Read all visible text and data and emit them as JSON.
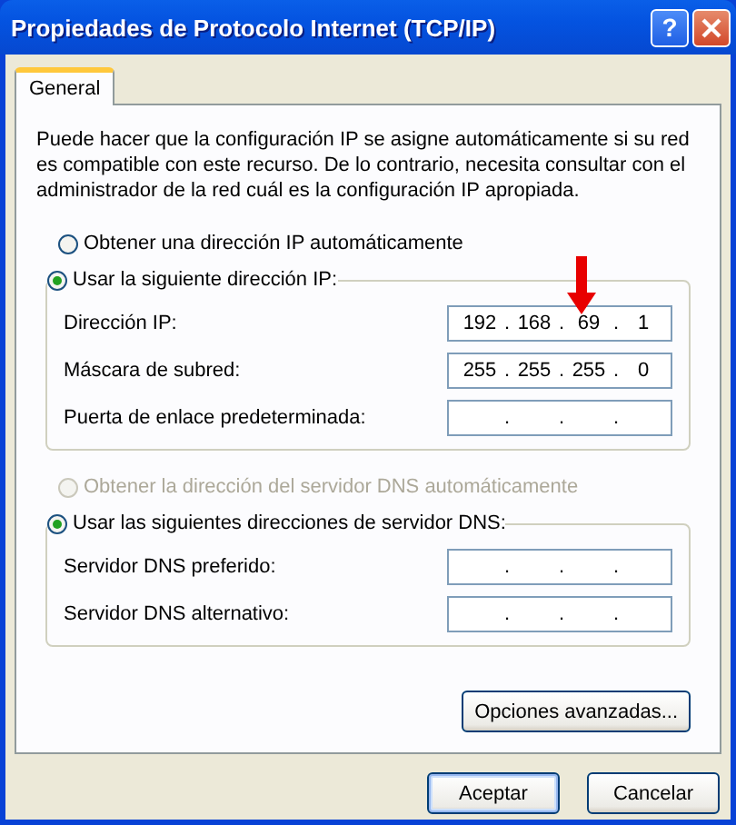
{
  "window": {
    "title": "Propiedades de Protocolo Internet (TCP/IP)",
    "help": "?"
  },
  "tabs": [
    {
      "label": "General",
      "selected": true
    }
  ],
  "description": "Puede hacer que la configuración IP se asigne automáticamente si su red es compatible con este recurso. De lo contrario, necesita consultar con el administrador de la red cuál es la configuración IP apropiada.",
  "sections": [
    {
      "options": [
        {
          "label": "Obtener una dirección IP automáticamente",
          "selected": false,
          "disabled": false
        },
        {
          "label": "Usar la siguiente dirección IP:",
          "selected": true,
          "disabled": false
        }
      ],
      "fields": [
        {
          "label": "Dirección IP:",
          "octets": [
            "192",
            "168",
            "69",
            "1"
          ],
          "dots": [
            ".",
            ".",
            "."
          ]
        },
        {
          "label": "Máscara de subred:",
          "octets": [
            "255",
            "255",
            "255",
            "0"
          ],
          "dots": [
            ".",
            ".",
            "."
          ]
        },
        {
          "label": "Puerta de enlace predeterminada:",
          "dots": [
            ".",
            ".",
            "."
          ]
        }
      ]
    },
    {
      "options": [
        {
          "label": "Obtener la dirección del servidor DNS automáticamente",
          "selected": false,
          "disabled": true
        },
        {
          "label": "Usar las siguientes direcciones de servidor DNS:",
          "selected": true,
          "disabled": false
        }
      ],
      "fields": [
        {
          "label": "Servidor DNS preferido:",
          "dots": [
            ".",
            ".",
            "."
          ]
        },
        {
          "label": "Servidor DNS alternativo:",
          "dots": [
            ".",
            ".",
            "."
          ]
        }
      ]
    }
  ],
  "advanced_button": "Opciones avanzadas...",
  "buttons": [
    {
      "label": "Aceptar",
      "default": true
    },
    {
      "label": "Cancelar",
      "default": false
    }
  ]
}
